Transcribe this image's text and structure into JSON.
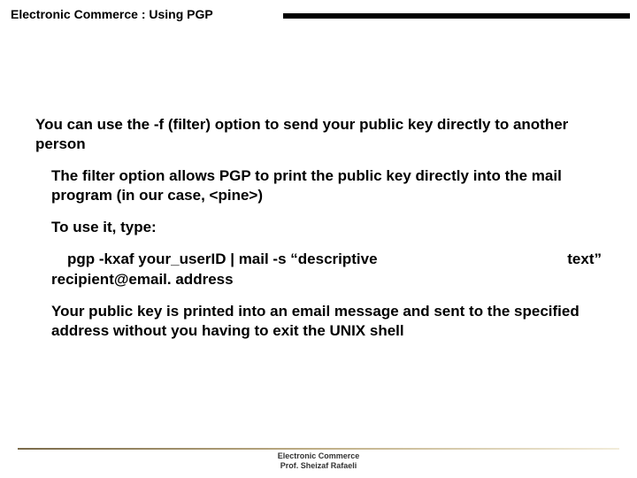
{
  "header": {
    "title": "Electronic Commerce :  Using PGP"
  },
  "body": {
    "lead": "You can use the -f (filter) option to send your public key directly to another person",
    "sub1": "The filter option allows PGP to print the public key directly into the mail program (in our case, <pine>)",
    "sub2": "To use it, type:",
    "cmd_left": "pgp -kxaf your_userID | mail -s “descriptive",
    "cmd_right": "text”",
    "cmd_cont": "recipient@email. address",
    "sub3": "Your public key is printed into an email message and sent to the specified address without you having to exit the UNIX shell"
  },
  "footer": {
    "line1": "Electronic Commerce",
    "line2": "Prof. Sheizaf Rafaeli"
  }
}
